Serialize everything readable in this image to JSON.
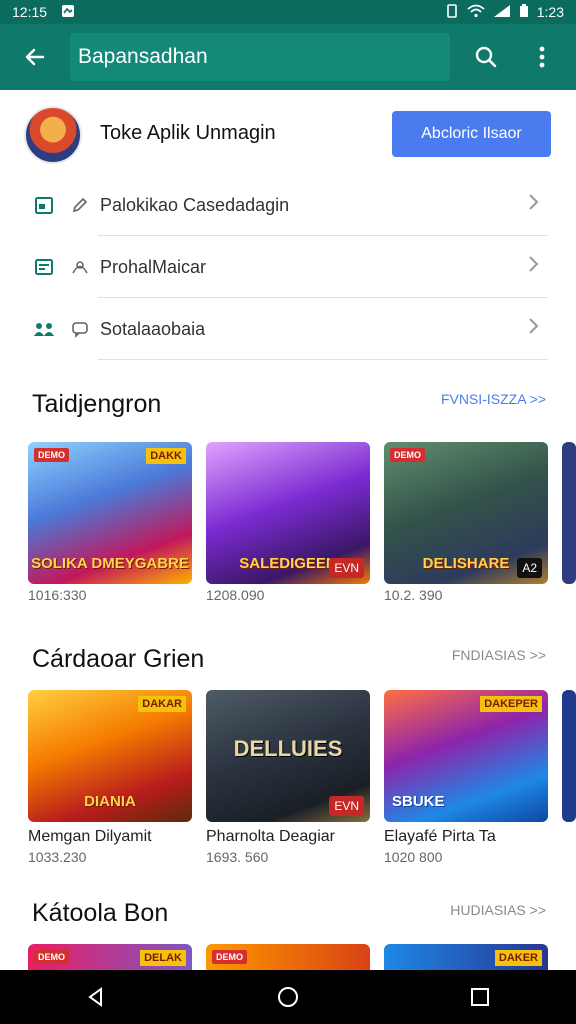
{
  "status_bar": {
    "left_time": "12:15",
    "right_time": "1:23"
  },
  "app_bar": {
    "search_value": "Bapansadhan"
  },
  "profile": {
    "name": "Toke Aplik Unmagin",
    "button_label": "Abcloric Ilsaor"
  },
  "menu": [
    {
      "label": "Palokikao Casedadagin"
    },
    {
      "label": "ProhalMaicar"
    },
    {
      "label": "Sotalaaobaia"
    }
  ],
  "sections": [
    {
      "title": "Taidjengron",
      "link": "FVNSI-ISZZA >>",
      "cards": [
        {
          "title": "",
          "meta": "1016:330",
          "tag": "DEMO",
          "tag2": "DAKK",
          "overlay": "SOLIKA DMEYGABRE",
          "badge": ""
        },
        {
          "title": "",
          "meta": "1208.090",
          "tag": "",
          "tag2": "",
          "overlay": "SALEDIGEEN",
          "badge": "EVN"
        },
        {
          "title": "",
          "meta": "10.2. 390",
          "tag": "DEMO",
          "tag2": "",
          "overlay": "DELISHARE",
          "badge": "A2"
        }
      ]
    },
    {
      "title": "Cárdaoar Grien",
      "link": "FNDIASIAS >>",
      "cards": [
        {
          "title": "Memgan Dilyamit",
          "meta": "1033.230",
          "tag": "",
          "tag2": "DAKAR",
          "overlay": "DIANIA",
          "badge": ""
        },
        {
          "title": "Pharnolta Deagiar",
          "meta": "1693. 560",
          "tag": "",
          "tag2": "",
          "overlay": "DELLUIES",
          "badge": "EVN"
        },
        {
          "title": "Elayafé Pirta Ta",
          "meta": "1020 800",
          "tag": "",
          "tag2": "DAKEPER",
          "overlay": "SBUKE",
          "badge": ""
        }
      ]
    },
    {
      "title": "Kátoola Bon",
      "link": "HUDIASIAS >>",
      "cards": [
        {
          "title": "",
          "meta": "",
          "tag": "DEMO",
          "tag2": "DELAK",
          "overlay": "",
          "badge": ""
        },
        {
          "title": "",
          "meta": "",
          "tag": "DEMO",
          "tag2": "",
          "overlay": "",
          "badge": ""
        },
        {
          "title": "",
          "meta": "",
          "tag": "",
          "tag2": "DAKER",
          "overlay": "",
          "badge": ""
        }
      ]
    }
  ],
  "colors": {
    "primary": "#0f7a6b",
    "accent_button": "#4a7cf0",
    "link": "#4a7cf0",
    "link_muted": "#8a8a8a"
  }
}
